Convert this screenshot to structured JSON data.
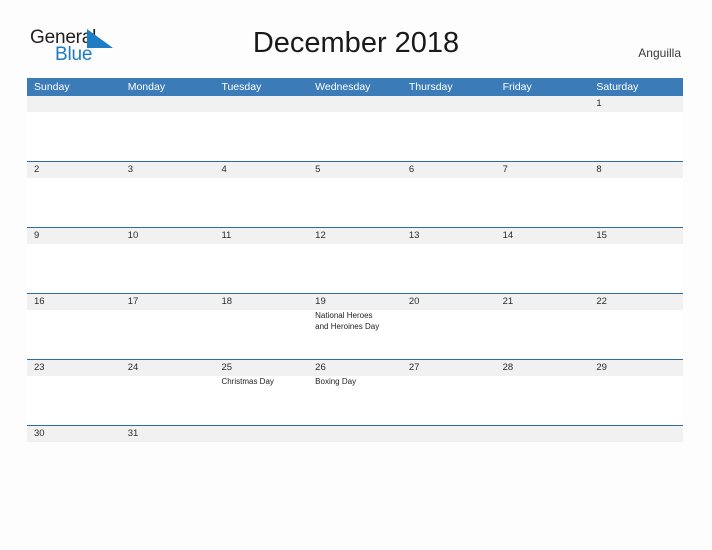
{
  "brand": {
    "name_part1": "General",
    "name_part2": "Blue",
    "flag_icon": "triangle-flag-icon",
    "color_dark": "#231f20",
    "color_blue": "#1d7cc4"
  },
  "header": {
    "title": "December 2018",
    "location": "Anguilla"
  },
  "theme": {
    "header_blue": "#3b7cb8",
    "separator_blue": "#2e6da4",
    "band_gray": "#f1f1f1",
    "page_background": "#fdfdfd"
  },
  "calendar": {
    "weekdays": [
      "Sunday",
      "Monday",
      "Tuesday",
      "Wednesday",
      "Thursday",
      "Friday",
      "Saturday"
    ],
    "weeks": [
      {
        "short": false,
        "days": [
          {
            "num": "",
            "events": ""
          },
          {
            "num": "",
            "events": ""
          },
          {
            "num": "",
            "events": ""
          },
          {
            "num": "",
            "events": ""
          },
          {
            "num": "",
            "events": ""
          },
          {
            "num": "",
            "events": ""
          },
          {
            "num": "1",
            "events": ""
          }
        ]
      },
      {
        "short": false,
        "days": [
          {
            "num": "2",
            "events": ""
          },
          {
            "num": "3",
            "events": ""
          },
          {
            "num": "4",
            "events": ""
          },
          {
            "num": "5",
            "events": ""
          },
          {
            "num": "6",
            "events": ""
          },
          {
            "num": "7",
            "events": ""
          },
          {
            "num": "8",
            "events": ""
          }
        ]
      },
      {
        "short": false,
        "days": [
          {
            "num": "9",
            "events": ""
          },
          {
            "num": "10",
            "events": ""
          },
          {
            "num": "11",
            "events": ""
          },
          {
            "num": "12",
            "events": ""
          },
          {
            "num": "13",
            "events": ""
          },
          {
            "num": "14",
            "events": ""
          },
          {
            "num": "15",
            "events": ""
          }
        ]
      },
      {
        "short": false,
        "days": [
          {
            "num": "16",
            "events": ""
          },
          {
            "num": "17",
            "events": ""
          },
          {
            "num": "18",
            "events": ""
          },
          {
            "num": "19",
            "events": "National Heroes\nand Heroines Day"
          },
          {
            "num": "20",
            "events": ""
          },
          {
            "num": "21",
            "events": ""
          },
          {
            "num": "22",
            "events": ""
          }
        ]
      },
      {
        "short": false,
        "days": [
          {
            "num": "23",
            "events": ""
          },
          {
            "num": "24",
            "events": ""
          },
          {
            "num": "25",
            "events": "Christmas Day"
          },
          {
            "num": "26",
            "events": "Boxing Day"
          },
          {
            "num": "27",
            "events": ""
          },
          {
            "num": "28",
            "events": ""
          },
          {
            "num": "29",
            "events": ""
          }
        ]
      },
      {
        "short": true,
        "days": [
          {
            "num": "30",
            "events": ""
          },
          {
            "num": "31",
            "events": ""
          },
          {
            "num": "",
            "events": ""
          },
          {
            "num": "",
            "events": ""
          },
          {
            "num": "",
            "events": ""
          },
          {
            "num": "",
            "events": ""
          },
          {
            "num": "",
            "events": ""
          }
        ]
      }
    ]
  }
}
